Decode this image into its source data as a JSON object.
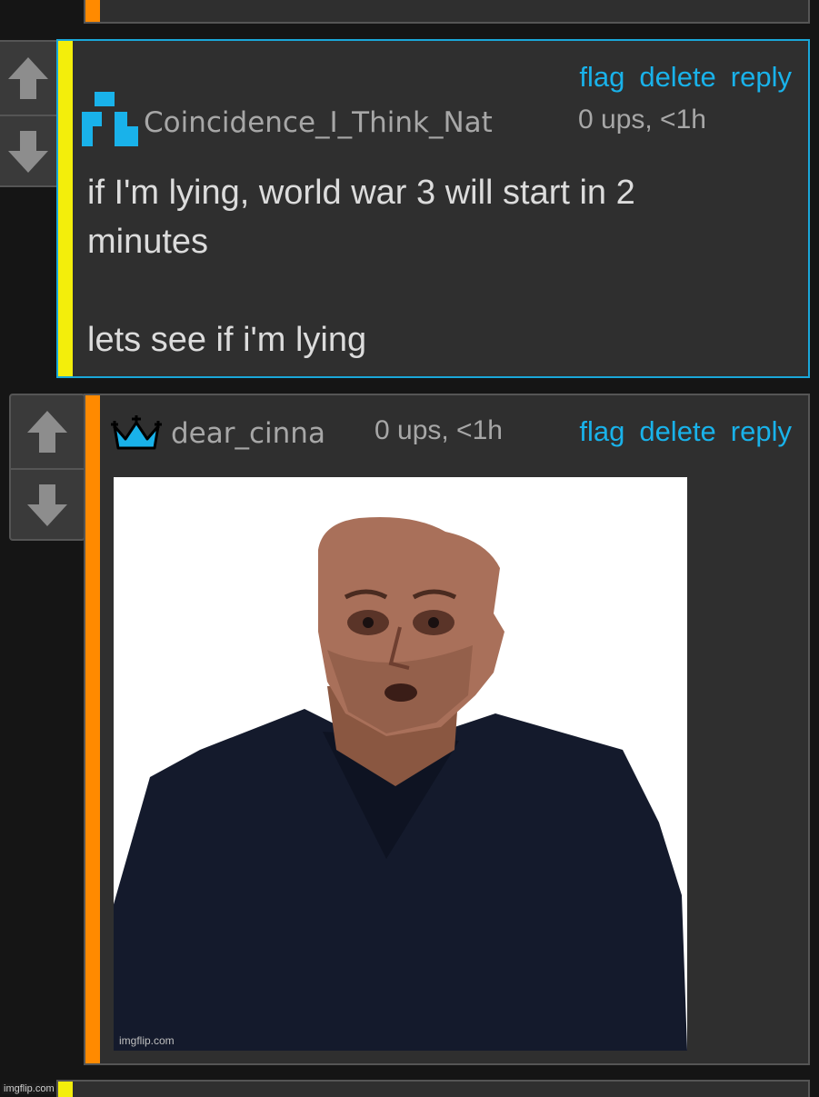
{
  "colors": {
    "link": "#19b2ea",
    "accent_highlight": "#f3ee0b",
    "accent_orange": "#ff8a00",
    "border_highlight": "#1aa7d9"
  },
  "icons": {
    "upvote": "arrow-up-icon",
    "downvote": "arrow-down-icon",
    "user1_avatar": "pixel-avatar-icon",
    "user2_badge": "crown-icon"
  },
  "comment1": {
    "username": "Coincidence_I_Think_Nat",
    "stats": "0 ups, <1h",
    "actions": {
      "flag": "flag",
      "delete": "delete",
      "reply": "reply"
    },
    "body": "if I'm lying, world war 3 will start in 2\nminutes\n\nlets see if i'm lying"
  },
  "comment2": {
    "username": "dear_cinna",
    "stats": "0 ups, <1h",
    "actions": {
      "flag": "flag",
      "delete": "delete",
      "reply": "reply"
    },
    "image_watermark": "imgflip.com"
  },
  "page_watermark": "imgflip.com"
}
